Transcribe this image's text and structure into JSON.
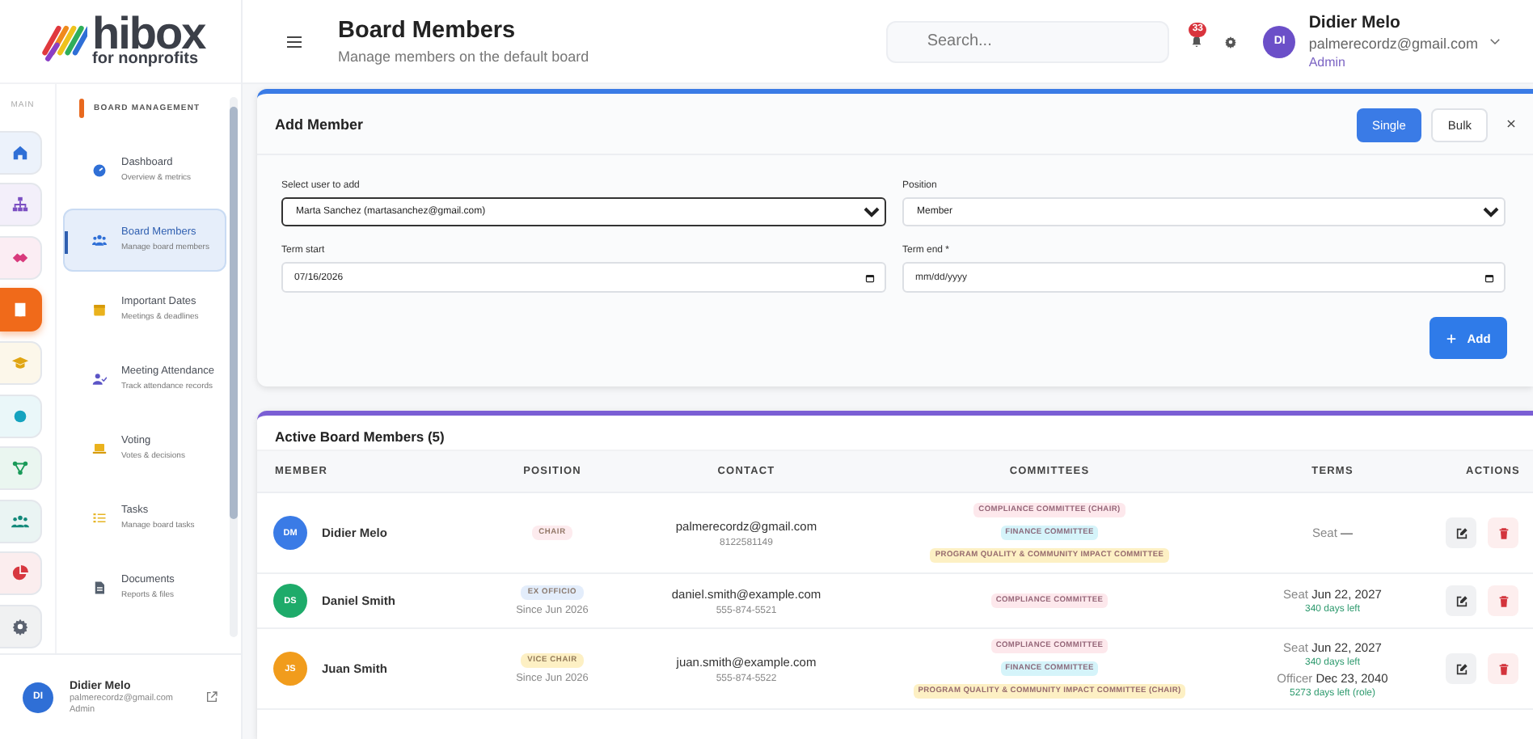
{
  "brand": {
    "name": "hibox",
    "tagline": "for nonprofits"
  },
  "header": {
    "title": "Board Members",
    "subtitle": "Manage members on the default board",
    "search": {
      "placeholder": "Search..."
    },
    "notification_count": "33",
    "user": {
      "initials": "DI",
      "name": "Didier Melo",
      "email": "palmerecordz@gmail.com",
      "role": "Admin",
      "color": "#6b4fc8"
    }
  },
  "rail": {
    "label": "MAIN",
    "items": [
      {
        "color": "#2f6fd6",
        "selected": false
      },
      {
        "color": "#7b4fc2",
        "selected": false
      },
      {
        "color": "#d83a7c",
        "selected": false
      },
      {
        "color": "#f06a1a",
        "selected": true
      },
      {
        "color": "#e0a512",
        "selected": false
      },
      {
        "color": "#15a3bf",
        "selected": false
      },
      {
        "color": "#1b9b5a",
        "selected": false
      },
      {
        "color": "#13897a",
        "selected": false
      },
      {
        "color": "#d7373f",
        "selected": false
      },
      {
        "color": "#5b6270",
        "selected": false
      }
    ]
  },
  "nav": {
    "section": "BOARD MANAGEMENT",
    "items": [
      {
        "label": "Dashboard",
        "description": "Overview & metrics",
        "selected": false
      },
      {
        "label": "Board Members",
        "description": "Manage board members",
        "selected": true
      },
      {
        "label": "Important Dates",
        "description": "Meetings & deadlines",
        "selected": false
      },
      {
        "label": "Meeting Attendance",
        "description": "Track attendance records",
        "selected": false
      },
      {
        "label": "Voting",
        "description": "Votes & decisions",
        "selected": false
      },
      {
        "label": "Tasks",
        "description": "Manage board tasks",
        "selected": false
      },
      {
        "label": "Documents",
        "description": "Reports & files",
        "selected": false
      }
    ]
  },
  "sidebar_user": {
    "initials": "DI",
    "name": "Didier Melo",
    "email": "palmerecordz@gmail.com",
    "role": "Admin",
    "color": "#2f6fd6"
  },
  "add_member": {
    "title": "Add Member",
    "modes": [
      {
        "label": "Single",
        "selected": true
      },
      {
        "label": "Bulk",
        "selected": false
      }
    ],
    "fields": [
      {
        "kind": "select",
        "label": "Select user to add",
        "value": "Marta Sanchez (martasanchez@gmail.com)",
        "focused": true
      },
      {
        "kind": "select",
        "label": "Position",
        "value": "Member",
        "focused": false
      },
      {
        "kind": "date",
        "label": "Term start",
        "value": "07/16/2026",
        "focused": false
      },
      {
        "kind": "date",
        "label": "Term end *",
        "placeholder": "mm/dd/yyyy",
        "focused": false
      }
    ],
    "add_button": "Add"
  },
  "members": {
    "title": "Active Board Members (5)",
    "columns": [
      "MEMBER",
      "POSITION",
      "CONTACT",
      "COMMITTEES",
      "TERMS",
      "ACTIONS"
    ],
    "rows": [
      {
        "initials": "DM",
        "color": "#3a7be6",
        "name": "Didier Melo",
        "position": {
          "label": "CHAIR",
          "color": "#fdebee"
        },
        "email": "palmerecordz@gmail.com",
        "phone": "8122581149",
        "committees": [
          {
            "label": "COMPLIANCE COMMITTEE (CHAIR)",
            "color": "#fde8ec"
          },
          {
            "label": "FINANCE COMMITTEE",
            "color": "#d5f4fa"
          },
          {
            "label": "PROGRAM QUALITY & COMMUNITY IMPACT COMMITTEE",
            "color": "#fdf0c4"
          }
        ],
        "terms": [
          {
            "label": "Seat",
            "date": "—"
          }
        ]
      },
      {
        "initials": "DS",
        "color": "#1eab6a",
        "name": "Daniel Smith",
        "position": {
          "label": "EX OFFICIO",
          "color": "#e3edfb"
        },
        "since": "Since Jun 2026",
        "email": "daniel.smith@example.com",
        "phone": "555-874-5521",
        "committees": [
          {
            "label": "COMPLIANCE COMMITTEE",
            "color": "#fde8ec"
          }
        ],
        "terms": [
          {
            "label": "Seat",
            "date": "Jun 22, 2027",
            "remaining": "340 days left"
          }
        ]
      },
      {
        "initials": "JS",
        "color": "#f19c1c",
        "name": "Juan Smith",
        "position": {
          "label": "VICE CHAIR",
          "color": "#fdf0c4"
        },
        "since": "Since Jun 2026",
        "email": "juan.smith@example.com",
        "phone": "555-874-5522",
        "committees": [
          {
            "label": "COMPLIANCE COMMITTEE",
            "color": "#fde8ec"
          },
          {
            "label": "FINANCE COMMITTEE",
            "color": "#d5f4fa"
          },
          {
            "label": "PROGRAM QUALITY & COMMUNITY IMPACT COMMITTEE (CHAIR)",
            "color": "#fdf0c4"
          }
        ],
        "terms": [
          {
            "label": "Seat",
            "date": "Jun 22, 2027",
            "remaining": "340 days left"
          },
          {
            "label": "Officer",
            "date": "Dec 23, 2040",
            "remaining": "5273 days left (role)"
          }
        ]
      }
    ]
  }
}
